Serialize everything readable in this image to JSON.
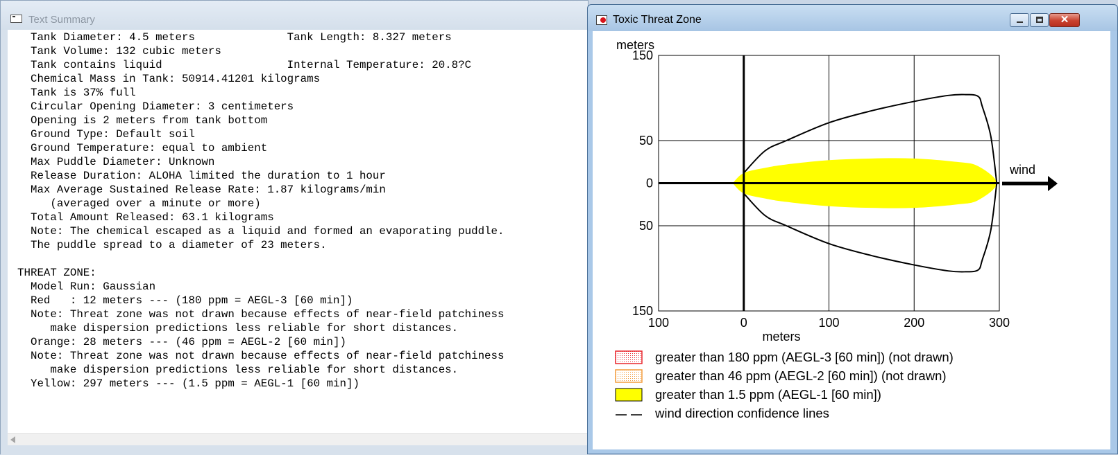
{
  "summary": {
    "title": "Text Summary",
    "lines": [
      "  Tank Diameter: 4.5 meters              Tank Length: 8.327 meters",
      "  Tank Volume: 132 cubic meters",
      "  Tank contains liquid                   Internal Temperature: 20.8?C",
      "  Chemical Mass in Tank: 50914.41201 kilograms",
      "  Tank is 37% full",
      "  Circular Opening Diameter: 3 centimeters",
      "  Opening is 2 meters from tank bottom",
      "  Ground Type: Default soil",
      "  Ground Temperature: equal to ambient",
      "  Max Puddle Diameter: Unknown",
      "  Release Duration: ALOHA limited the duration to 1 hour",
      "  Max Average Sustained Release Rate: 1.87 kilograms/min",
      "     (averaged over a minute or more)",
      "  Total Amount Released: 63.1 kilograms",
      "  Note: The chemical escaped as a liquid and formed an evaporating puddle.",
      "  The puddle spread to a diameter of 23 meters.",
      "",
      "THREAT ZONE:",
      "  Model Run: Gaussian",
      "  Red   : 12 meters --- (180 ppm = AEGL-3 [60 min])",
      "  Note: Threat zone was not drawn because effects of near-field patchiness",
      "     make dispersion predictions less reliable for short distances.",
      "  Orange: 28 meters --- (46 ppm = AEGL-2 [60 min])",
      "  Note: Threat zone was not drawn because effects of near-field patchiness",
      "     make dispersion predictions less reliable for short distances.",
      "  Yellow: 297 meters --- (1.5 ppm = AEGL-1 [60 min])"
    ]
  },
  "threat": {
    "title": "Toxic Threat Zone",
    "close_glyph": "✕",
    "wind_label": "wind"
  },
  "chart_data": {
    "type": "area",
    "title": "",
    "xlabel": "meters",
    "ylabel": "meters",
    "xlim": [
      -100,
      300
    ],
    "ylim": [
      -150,
      150
    ],
    "x_ticks": [
      -100,
      0,
      100,
      200,
      300
    ],
    "x_tick_labels": [
      "100",
      "0",
      "100",
      "200",
      "300"
    ],
    "y_ticks": [
      150,
      50,
      0,
      -50,
      -150
    ],
    "y_tick_labels": [
      "150",
      "50",
      "0",
      "50",
      "150"
    ],
    "grid": true,
    "threat_zone": {
      "name": "greater than 1.5 ppm (AEGL-1 [60 min])",
      "color": "#ffff00",
      "x": [
        -13,
        0,
        25,
        50,
        100,
        150,
        200,
        250,
        275,
        297
      ],
      "half_width": [
        0,
        12,
        18,
        22,
        27,
        29,
        29,
        25,
        20,
        0
      ]
    },
    "confidence_lines": {
      "name": "wind direction confidence lines",
      "x": [
        0,
        25,
        50,
        100,
        150,
        200,
        240,
        260,
        275,
        280,
        290,
        297
      ],
      "half_width": [
        12,
        38,
        50,
        71,
        85,
        96,
        103,
        104,
        102,
        90,
        55,
        0
      ]
    },
    "legend": [
      {
        "label": "greater than 180 ppm (AEGL-3 [60 min]) (not drawn)",
        "color": "#e8242b",
        "style": "dotted"
      },
      {
        "label": "greater than 46 ppm (AEGL-2 [60 min]) (not drawn)",
        "color": "#f39c3c",
        "style": "dotted"
      },
      {
        "label": "greater than 1.5 ppm (AEGL-1 [60 min])",
        "color": "#ffff00",
        "style": "solid"
      },
      {
        "label": "wind direction confidence lines",
        "color": "#000000",
        "style": "dashed-line"
      }
    ],
    "legend_position": "bottom"
  }
}
